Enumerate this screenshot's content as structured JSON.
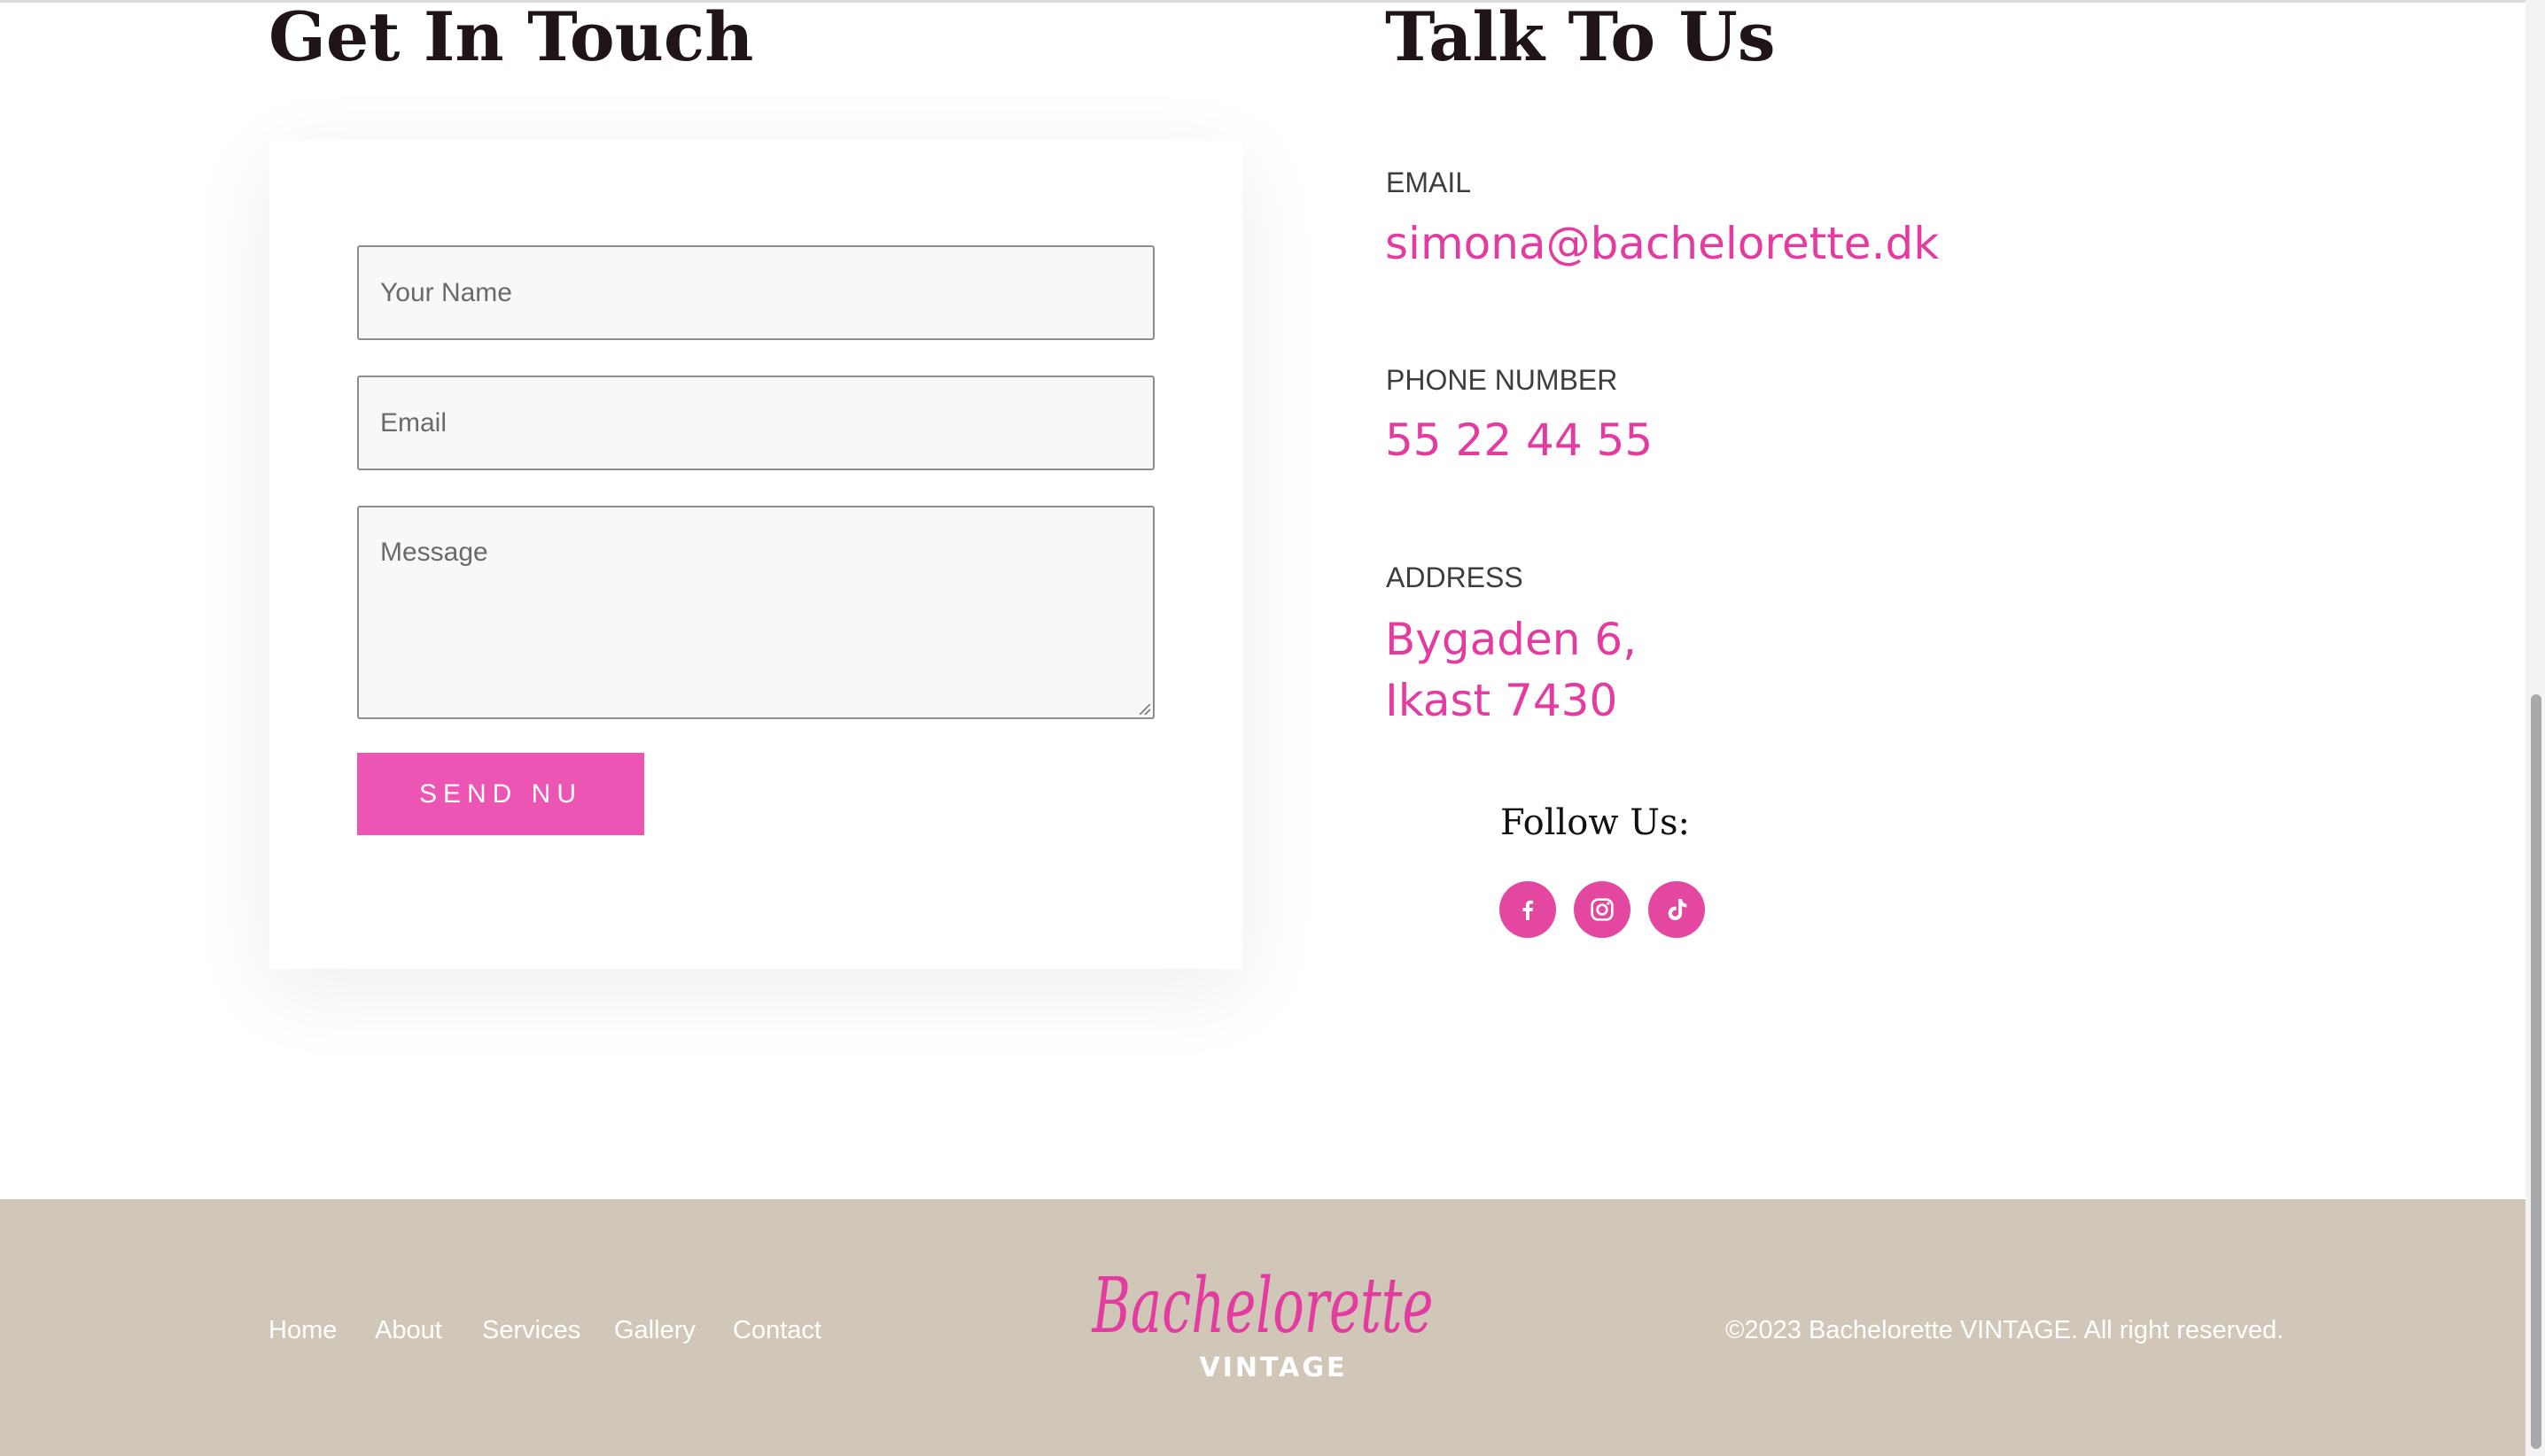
{
  "contact_form": {
    "heading": "Get In Touch",
    "name_placeholder": "Your Name",
    "email_placeholder": "Email",
    "message_placeholder": "Message",
    "send_label": "SEND NU"
  },
  "contact_info": {
    "heading": "Talk To Us",
    "email_label": "EMAIL",
    "email_value": "simona@bachelorette.dk",
    "phone_label": "PHONE NUMBER",
    "phone_value": "55 22 44 55",
    "address_label": "ADDRESS",
    "address_line1": "Bygaden 6,",
    "address_line2": "Ikast 7430"
  },
  "social": {
    "title": "Follow Us:",
    "icons": [
      "facebook-icon",
      "instagram-icon",
      "tiktok-icon"
    ]
  },
  "footer": {
    "nav": [
      "Home",
      "About",
      "Services",
      "Gallery",
      "Contact"
    ],
    "logo_script": "Bachelorette",
    "logo_sub": "VINTAGE",
    "copyright": "©2023 Bachelorette VINTAGE. All right reserved."
  },
  "colors": {
    "accent": "#ed55b4",
    "link_pink": "#e33ba0",
    "heading": "#1f1418",
    "footer_bg": "#d0c7b8"
  }
}
